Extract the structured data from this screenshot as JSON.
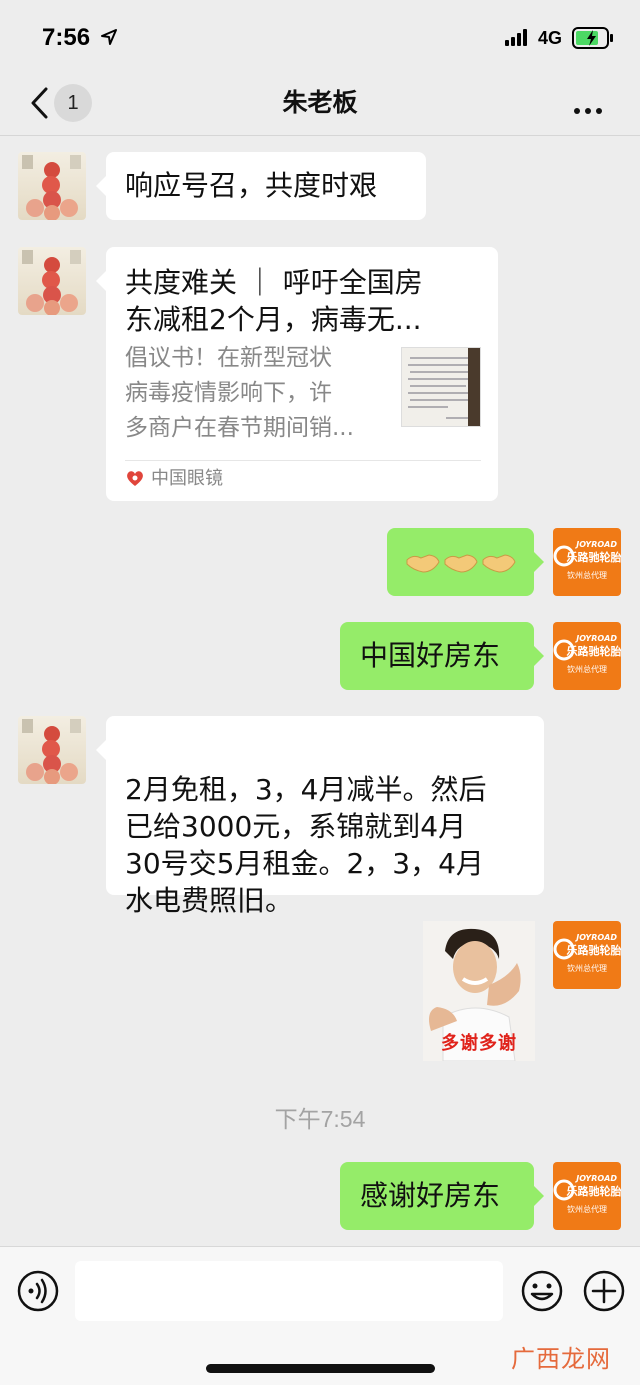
{
  "status_bar": {
    "time": "7:56",
    "network": "4G"
  },
  "nav": {
    "unread_count": "1",
    "title": "朱老板"
  },
  "messages": {
    "m1": "响应号召，共度时艰",
    "card": {
      "title": "共度难关 ｜ 呼吁全国房\n东减租2个月，病毒无...",
      "description": "倡议书！在新型冠状\n病毒疫情影响下，许\n多商户在春节期间销...",
      "source": "中国眼镜"
    },
    "m3": "🤝🤝🤝",
    "m4": "中国好房东",
    "m5": "2月免租，3，4月减半。然后\n已给3000元，系锦就到4月\n30号交5月租金。2，3，4月\n水电费照旧。",
    "sticker_text": "多谢多谢",
    "time_divider": "下午7:54",
    "m7": "感谢好房东"
  },
  "brand_logo": {
    "name": "JOYROAD",
    "cn": "乐路驰轮胎",
    "sub": "钦州总代理"
  },
  "watermark": "广西龙网",
  "colors": {
    "bubble_sent": "#95ec69",
    "bubble_received": "#ffffff",
    "background": "#ededed",
    "logo_orange": "#f07a16"
  }
}
